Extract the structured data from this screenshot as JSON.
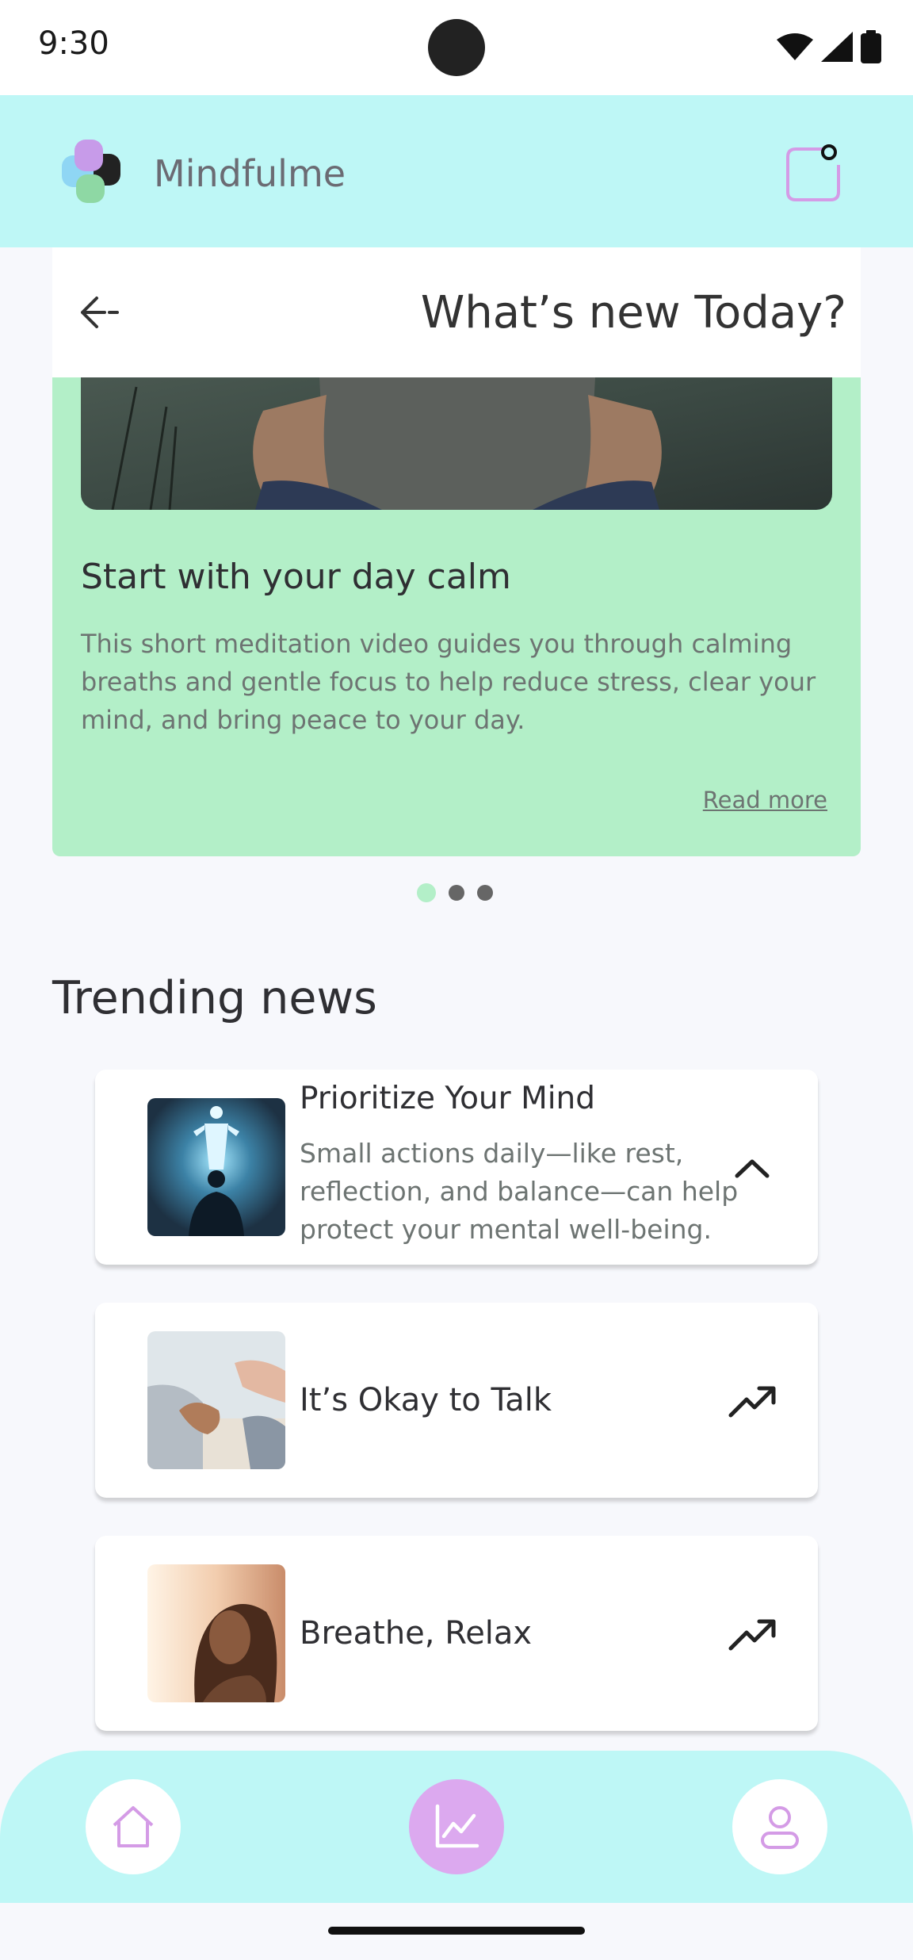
{
  "status_bar": {
    "time": "9:30"
  },
  "app": {
    "name": "Mindfulme"
  },
  "featured": {
    "header_title": "What’s new Today?",
    "title": "Start with your day calm",
    "description": "This short meditation video guides you through calming breaths and gentle focus to help reduce stress, clear your mind, and bring peace to your day.",
    "read_more": "Read more",
    "carousel": {
      "count": 3,
      "active": 1
    }
  },
  "trending": {
    "title": "Trending news",
    "items": [
      {
        "title": "Prioritize Your Mind",
        "description": "Small actions daily—like rest, reflection, and balance—can help protect your mental well-being.",
        "expanded": true,
        "action_icon": "chevron-up-icon"
      },
      {
        "title": "It’s Okay to Talk",
        "expanded": false,
        "action_icon": "trending-up-icon"
      },
      {
        "title": "Breathe, Relax",
        "expanded": false,
        "action_icon": "trending-up-icon"
      }
    ]
  },
  "nav": {
    "items": [
      {
        "icon": "home-icon",
        "active": false
      },
      {
        "icon": "chart-icon",
        "active": true
      },
      {
        "icon": "profile-icon",
        "active": false
      }
    ]
  },
  "colors": {
    "header_bg": "#bef7f6",
    "feature_bg": "#b3efc8",
    "accent": "#dca9ef",
    "text": "#2f2f33"
  }
}
